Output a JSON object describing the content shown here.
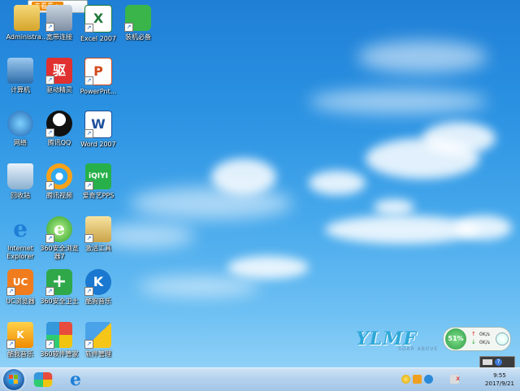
{
  "top_banner": {
    "text": "去看看 >"
  },
  "desktop_icons": [
    {
      "label": "Administra...",
      "icon": "user-folder-icon",
      "shortcut": false
    },
    {
      "label": "宽带连接",
      "icon": "broadband-icon",
      "shortcut": true
    },
    {
      "label": "Excel 2007",
      "icon": "excel-icon",
      "shortcut": true
    },
    {
      "label": "装机必备",
      "icon": "shopping-bag-icon",
      "shortcut": true
    },
    {
      "label": "计算机",
      "icon": "computer-icon",
      "shortcut": false
    },
    {
      "label": "驱动精灵",
      "icon": "driver-genius-icon",
      "shortcut": true
    },
    {
      "label": "PowerPnt...",
      "icon": "powerpoint-icon",
      "shortcut": true
    },
    {
      "label": "网络",
      "icon": "network-icon",
      "shortcut": false
    },
    {
      "label": "腾讯QQ",
      "icon": "qq-penguin-icon",
      "shortcut": true
    },
    {
      "label": "Word 2007",
      "icon": "word-icon",
      "shortcut": true
    },
    {
      "label": "回收站",
      "icon": "recycle-bin-icon",
      "shortcut": false
    },
    {
      "label": "腾讯视频",
      "icon": "tencent-video-icon",
      "shortcut": true
    },
    {
      "label": "爱奇艺PPS",
      "icon": "iqiyi-icon",
      "shortcut": true
    },
    {
      "label": "Internet\nExplorer",
      "icon": "internet-explorer-icon",
      "shortcut": false
    },
    {
      "label": "360安全浏览\n器7",
      "icon": "360-browser-icon",
      "shortcut": true
    },
    {
      "label": "激活工具",
      "icon": "activation-tool-icon",
      "shortcut": true
    },
    {
      "label": "UC浏览器",
      "icon": "uc-browser-icon",
      "shortcut": true
    },
    {
      "label": "360安全卫士",
      "icon": "360-guard-icon",
      "shortcut": true
    },
    {
      "label": "酷狗音乐",
      "icon": "kugou-icon",
      "shortcut": true
    },
    {
      "label": "酷我音乐",
      "icon": "kuwo-icon",
      "shortcut": true
    },
    {
      "label": "360软件管家",
      "icon": "360-software-icon",
      "shortcut": true
    },
    {
      "label": "软件管理",
      "icon": "software-manager-icon",
      "shortcut": true
    }
  ],
  "watermark": {
    "logo": "YLMF",
    "tagline": "SOAR ABOVE"
  },
  "net_widget": {
    "percent": "51%",
    "upload": "0K/s",
    "download": "0K/s"
  },
  "taskbar": {
    "start_icon": "windows-start-icon",
    "pinned": [
      {
        "name": "media-player-icon"
      },
      {
        "name": "internet-explorer-icon"
      }
    ],
    "clock": {
      "time": "9:55",
      "date": "2017/9/21"
    }
  },
  "colors": {
    "taskbar": "#b4d2ee",
    "sky_top": "#1f7fd6",
    "sky_bottom": "#8fd1f7"
  }
}
